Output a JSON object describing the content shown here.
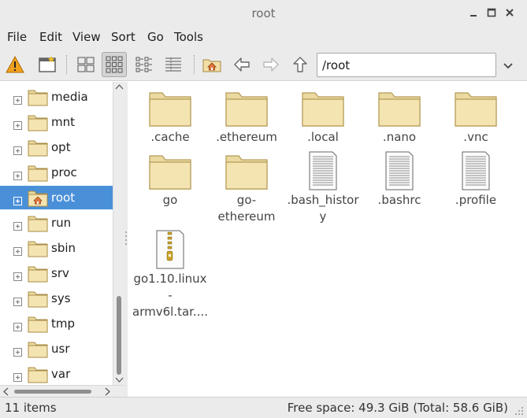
{
  "window": {
    "title": "root"
  },
  "menubar": [
    "File",
    "Edit",
    "View",
    "Sort",
    "Go",
    "Tools"
  ],
  "toolbar": {
    "path_value": "/root",
    "buttons": [
      "warning-icon",
      "new-window-icon",
      "icon-view-icon",
      "thumbnail-view-icon",
      "compact-view-icon",
      "detailed-list-icon",
      "home-icon",
      "back-icon",
      "forward-icon",
      "up-icon"
    ]
  },
  "sidebar": {
    "items": [
      {
        "label": "media",
        "selected": false,
        "icon": "folder-icon"
      },
      {
        "label": "mnt",
        "selected": false,
        "icon": "folder-icon"
      },
      {
        "label": "opt",
        "selected": false,
        "icon": "folder-icon"
      },
      {
        "label": "proc",
        "selected": false,
        "icon": "folder-icon"
      },
      {
        "label": "root",
        "selected": true,
        "icon": "home-folder-icon"
      },
      {
        "label": "run",
        "selected": false,
        "icon": "folder-icon"
      },
      {
        "label": "sbin",
        "selected": false,
        "icon": "folder-icon"
      },
      {
        "label": "srv",
        "selected": false,
        "icon": "folder-icon"
      },
      {
        "label": "sys",
        "selected": false,
        "icon": "folder-icon"
      },
      {
        "label": "tmp",
        "selected": false,
        "icon": "folder-icon"
      },
      {
        "label": "usr",
        "selected": false,
        "icon": "folder-icon"
      },
      {
        "label": "var",
        "selected": false,
        "icon": "folder-icon"
      }
    ]
  },
  "files": [
    {
      "name": ".cache",
      "type": "folder"
    },
    {
      "name": ".ethereum",
      "type": "folder"
    },
    {
      "name": ".local",
      "type": "folder"
    },
    {
      "name": ".nano",
      "type": "folder"
    },
    {
      "name": ".vnc",
      "type": "folder"
    },
    {
      "name": "go",
      "type": "folder"
    },
    {
      "name": "go-\nethereum",
      "type": "folder"
    },
    {
      "name": ".bash_histor\ny",
      "type": "text"
    },
    {
      "name": ".bashrc",
      "type": "text"
    },
    {
      "name": ".profile",
      "type": "text"
    },
    {
      "name": "go1.10.linux\n-\narmv6l.tar....",
      "type": "archive"
    }
  ],
  "status": {
    "items_count": "11 items",
    "free_space": "Free space: 49.3 GiB (Total: 58.6 GiB)"
  },
  "colors": {
    "selection": "#4a90d9",
    "folder": "#f2dfa6"
  }
}
